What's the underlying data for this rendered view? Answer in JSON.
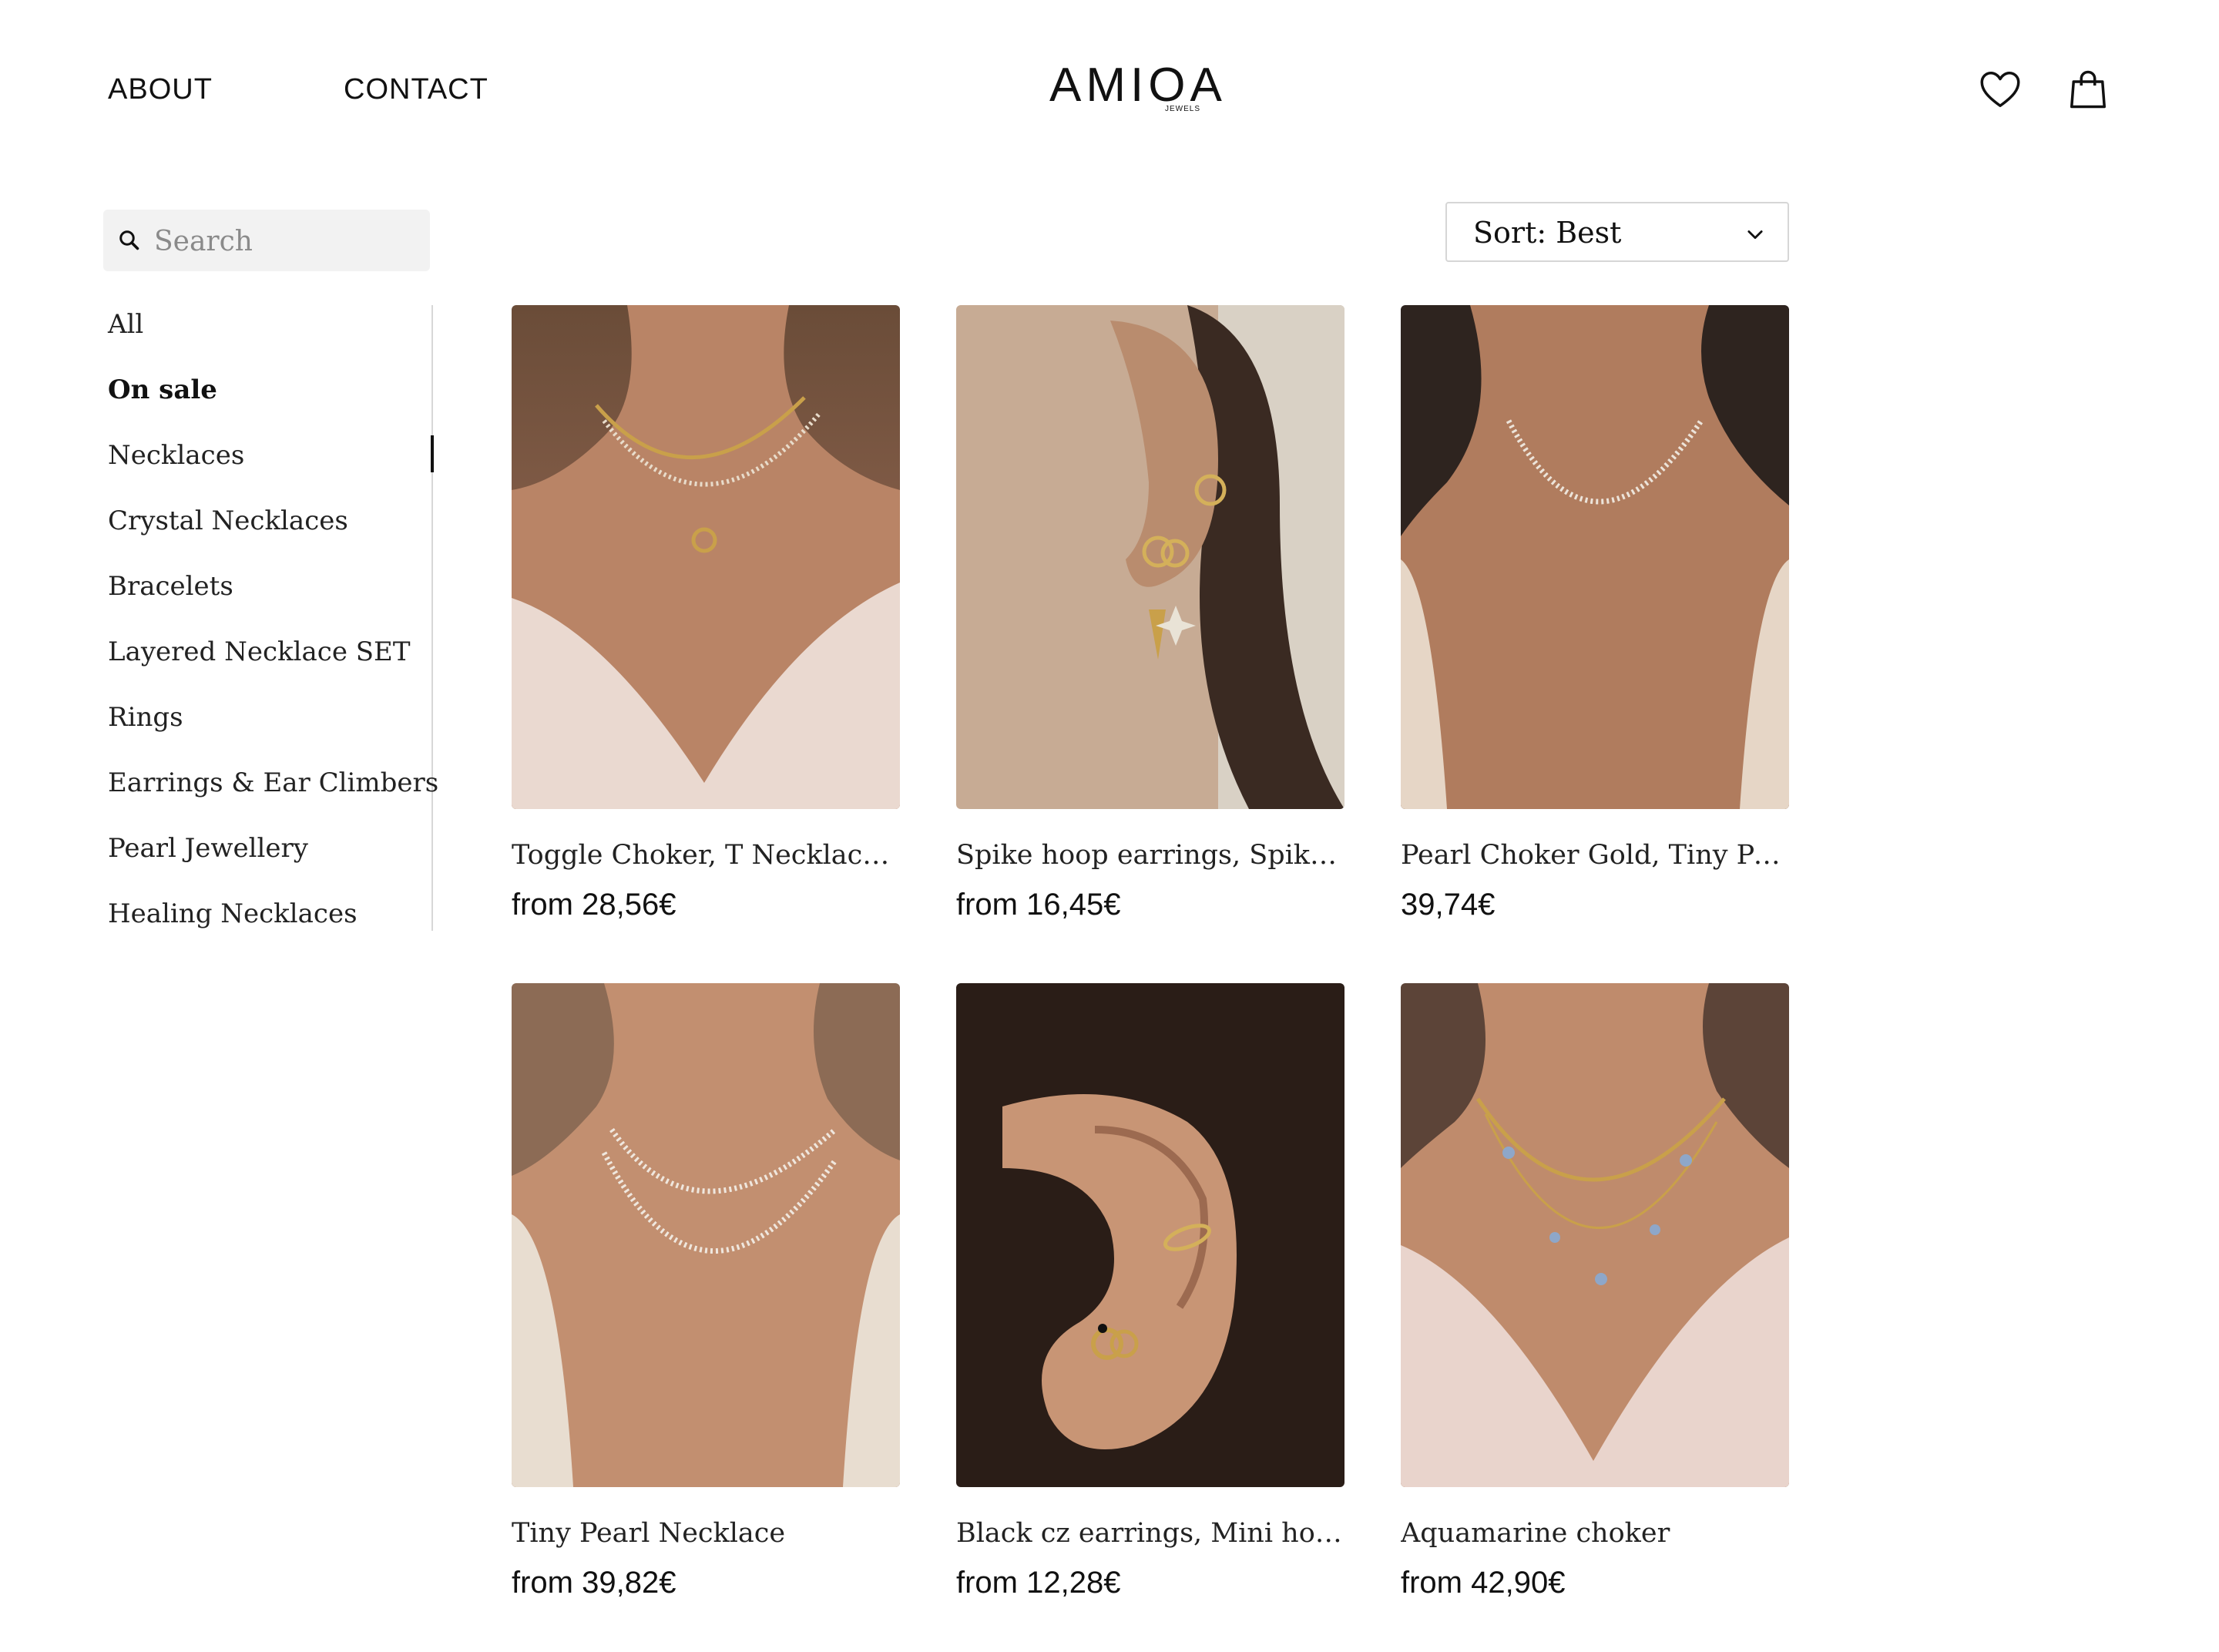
{
  "header": {
    "nav": [
      {
        "label": "ABOUT"
      },
      {
        "label": "CONTACT"
      }
    ],
    "logo": {
      "text": "AMIOA",
      "subtext": "JEWELS"
    },
    "icons": [
      "heart-icon",
      "shopping-bag-icon"
    ]
  },
  "sidebar": {
    "search": {
      "placeholder": "Search",
      "value": ""
    },
    "categories": [
      {
        "label": "All",
        "active": false
      },
      {
        "label": "On sale",
        "active": true
      },
      {
        "label": "Necklaces",
        "active": false
      },
      {
        "label": "Crystal Necklaces",
        "active": false
      },
      {
        "label": "Bracelets",
        "active": false
      },
      {
        "label": "Layered Necklace SET",
        "active": false
      },
      {
        "label": "Rings",
        "active": false
      },
      {
        "label": "Earrings & Ear Climbers",
        "active": false
      },
      {
        "label": "Pearl Jewellery",
        "active": false
      },
      {
        "label": "Healing Necklaces",
        "active": false
      }
    ]
  },
  "sort": {
    "label": "Sort: Best",
    "icon": "chevron-down-icon"
  },
  "products": [
    {
      "name": "Toggle Choker, T Necklace, ...",
      "price": "from 28,56€"
    },
    {
      "name": "Spike hoop earrings, Spike...",
      "price": "from 16,45€"
    },
    {
      "name": "Pearl Choker Gold, Tiny Pearl...",
      "price": "39,74€"
    },
    {
      "name": "Tiny Pearl Necklace",
      "price": "from 39,82€"
    },
    {
      "name": "Black cz earrings, Mini hoop...",
      "price": "from 12,28€"
    },
    {
      "name": "Aquamarine choker",
      "price": "from 42,90€"
    }
  ],
  "colors": {
    "text": "#111111",
    "divider": "#d7d7d7",
    "search_bg": "#f2f2f2"
  }
}
